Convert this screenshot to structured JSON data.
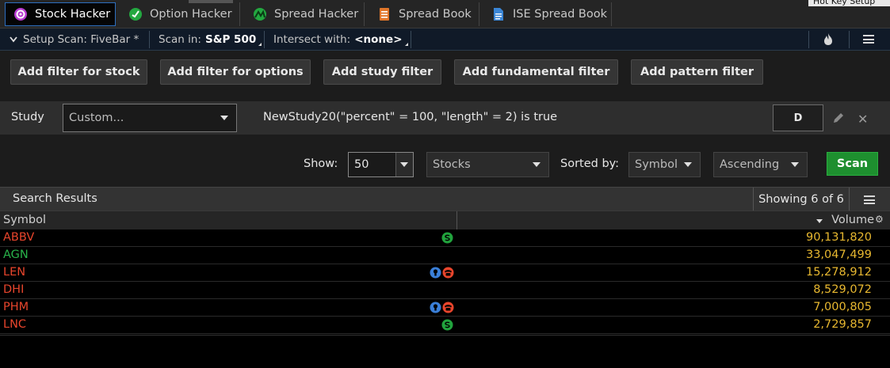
{
  "tabs": [
    {
      "label": "Stock Hacker",
      "icon": "stock-hacker-icon",
      "active": true
    },
    {
      "label": "Option Hacker",
      "icon": "option-hacker-icon",
      "active": false
    },
    {
      "label": "Spread Hacker",
      "icon": "spread-hacker-icon",
      "active": false
    },
    {
      "label": "Spread Book",
      "icon": "spread-book-icon",
      "active": false
    },
    {
      "label": "ISE Spread Book",
      "icon": "ise-spread-book-icon",
      "active": false
    }
  ],
  "hotkey_label": "Hot Key Setup",
  "setup": {
    "scan_label": "Setup Scan: FiveBar *",
    "scan_in_label": "Scan in:",
    "scan_in_value": "S&P 500",
    "intersect_label": "Intersect with:",
    "intersect_value": "<none>"
  },
  "filter_buttons": [
    "Add filter for stock",
    "Add filter for options",
    "Add study filter",
    "Add fundamental filter",
    "Add pattern filter"
  ],
  "study": {
    "label": "Study",
    "select_value": "Custom...",
    "expression": "NewStudy20(\"percent\" = 100, \"length\" = 2) is true",
    "aggregation": "D"
  },
  "options": {
    "show_label": "Show:",
    "show_value": "50",
    "type_value": "Stocks",
    "sorted_label": "Sorted by:",
    "sort_field": "Symbol",
    "sort_order": "Ascending",
    "scan_button": "Scan"
  },
  "results": {
    "title": "Search Results",
    "showing": "Showing 6 of 6",
    "columns": {
      "symbol": "Symbol",
      "volume": "Volume"
    },
    "rows": [
      {
        "symbol": "ABBV",
        "color": "#e8452c",
        "icons": [
          "dividend-icon"
        ],
        "volume": "90,131,820"
      },
      {
        "symbol": "AGN",
        "color": "#29b24a",
        "icons": [],
        "volume": "33,047,499"
      },
      {
        "symbol": "LEN",
        "color": "#e8452c",
        "icons": [
          "earnings-bulb-icon",
          "conference-call-icon"
        ],
        "volume": "15,278,912"
      },
      {
        "symbol": "DHI",
        "color": "#e8452c",
        "icons": [],
        "volume": "8,529,072"
      },
      {
        "symbol": "PHM",
        "color": "#e8452c",
        "icons": [
          "earnings-bulb-icon",
          "conference-call-icon"
        ],
        "volume": "7,000,805"
      },
      {
        "symbol": "LNC",
        "color": "#e8452c",
        "icons": [
          "dividend-icon"
        ],
        "volume": "2,729,857"
      }
    ]
  },
  "colors": {
    "accent": "#2d6fc0",
    "scan_green": "#1e8f2f",
    "volume": "#e8b830",
    "down": "#e8452c",
    "up": "#29b24a"
  }
}
